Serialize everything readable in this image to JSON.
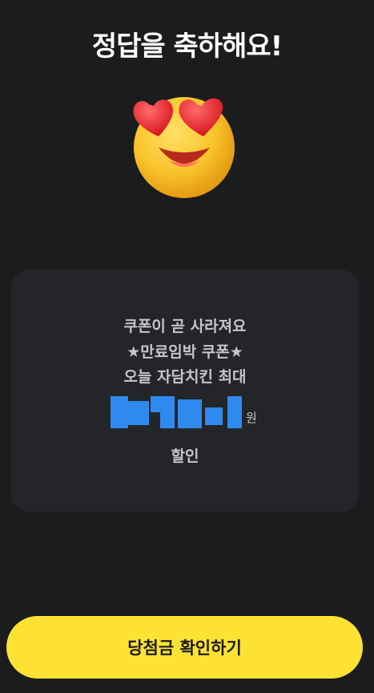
{
  "header": {
    "title": "정답을 축하해요!"
  },
  "emoji": {
    "icon": "heart-eyes-smiley-icon"
  },
  "coupon": {
    "line1": "쿠폰이 곧 사라져요",
    "line2": "★만료임박 쿠폰★",
    "line3": "오늘 자담치킨 최대",
    "currency": "원",
    "discount_label": "할인"
  },
  "cta": {
    "label": "당첨금 확인하기"
  },
  "colors": {
    "background": "#1b1c1e",
    "card": "#232528",
    "accent_yellow": "#fde234",
    "redacted_blue": "#2f8af0"
  }
}
